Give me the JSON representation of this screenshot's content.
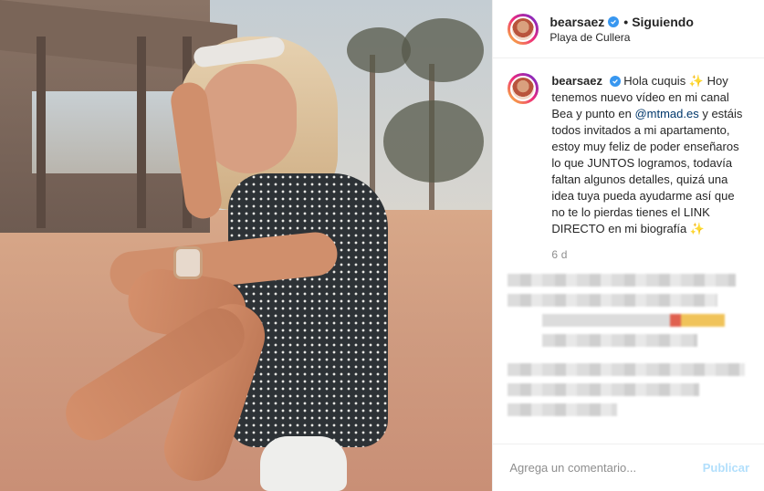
{
  "post": {
    "username": "bearsaez",
    "follow_status": "Siguiendo",
    "location": "Playa de Cullera",
    "caption": {
      "username": "bearsaez",
      "text_before_mention": "Hola cuquis ✨ Hoy tenemos nuevo vídeo en mi canal Bea y punto en ",
      "mention": "@mtmad.es",
      "text_after_mention": " y estáis todos invitados a mi apartamento, estoy muy feliz de poder enseñaros lo que JUNTOS logramos, todavía faltan algunos detalles, quizá una idea tuya pueda ayudarme así que no te lo pierdas tienes el LINK DIRECTO en mi biografía ✨"
    },
    "time_ago": "6 d"
  },
  "composer": {
    "placeholder": "Agrega un comentario...",
    "publish_label": "Publicar"
  },
  "colors": {
    "verified": "#3897f0",
    "publish_disabled": "#b2dffc",
    "mention": "#00376b"
  },
  "icons": {
    "verified": "verified-badge-icon"
  }
}
